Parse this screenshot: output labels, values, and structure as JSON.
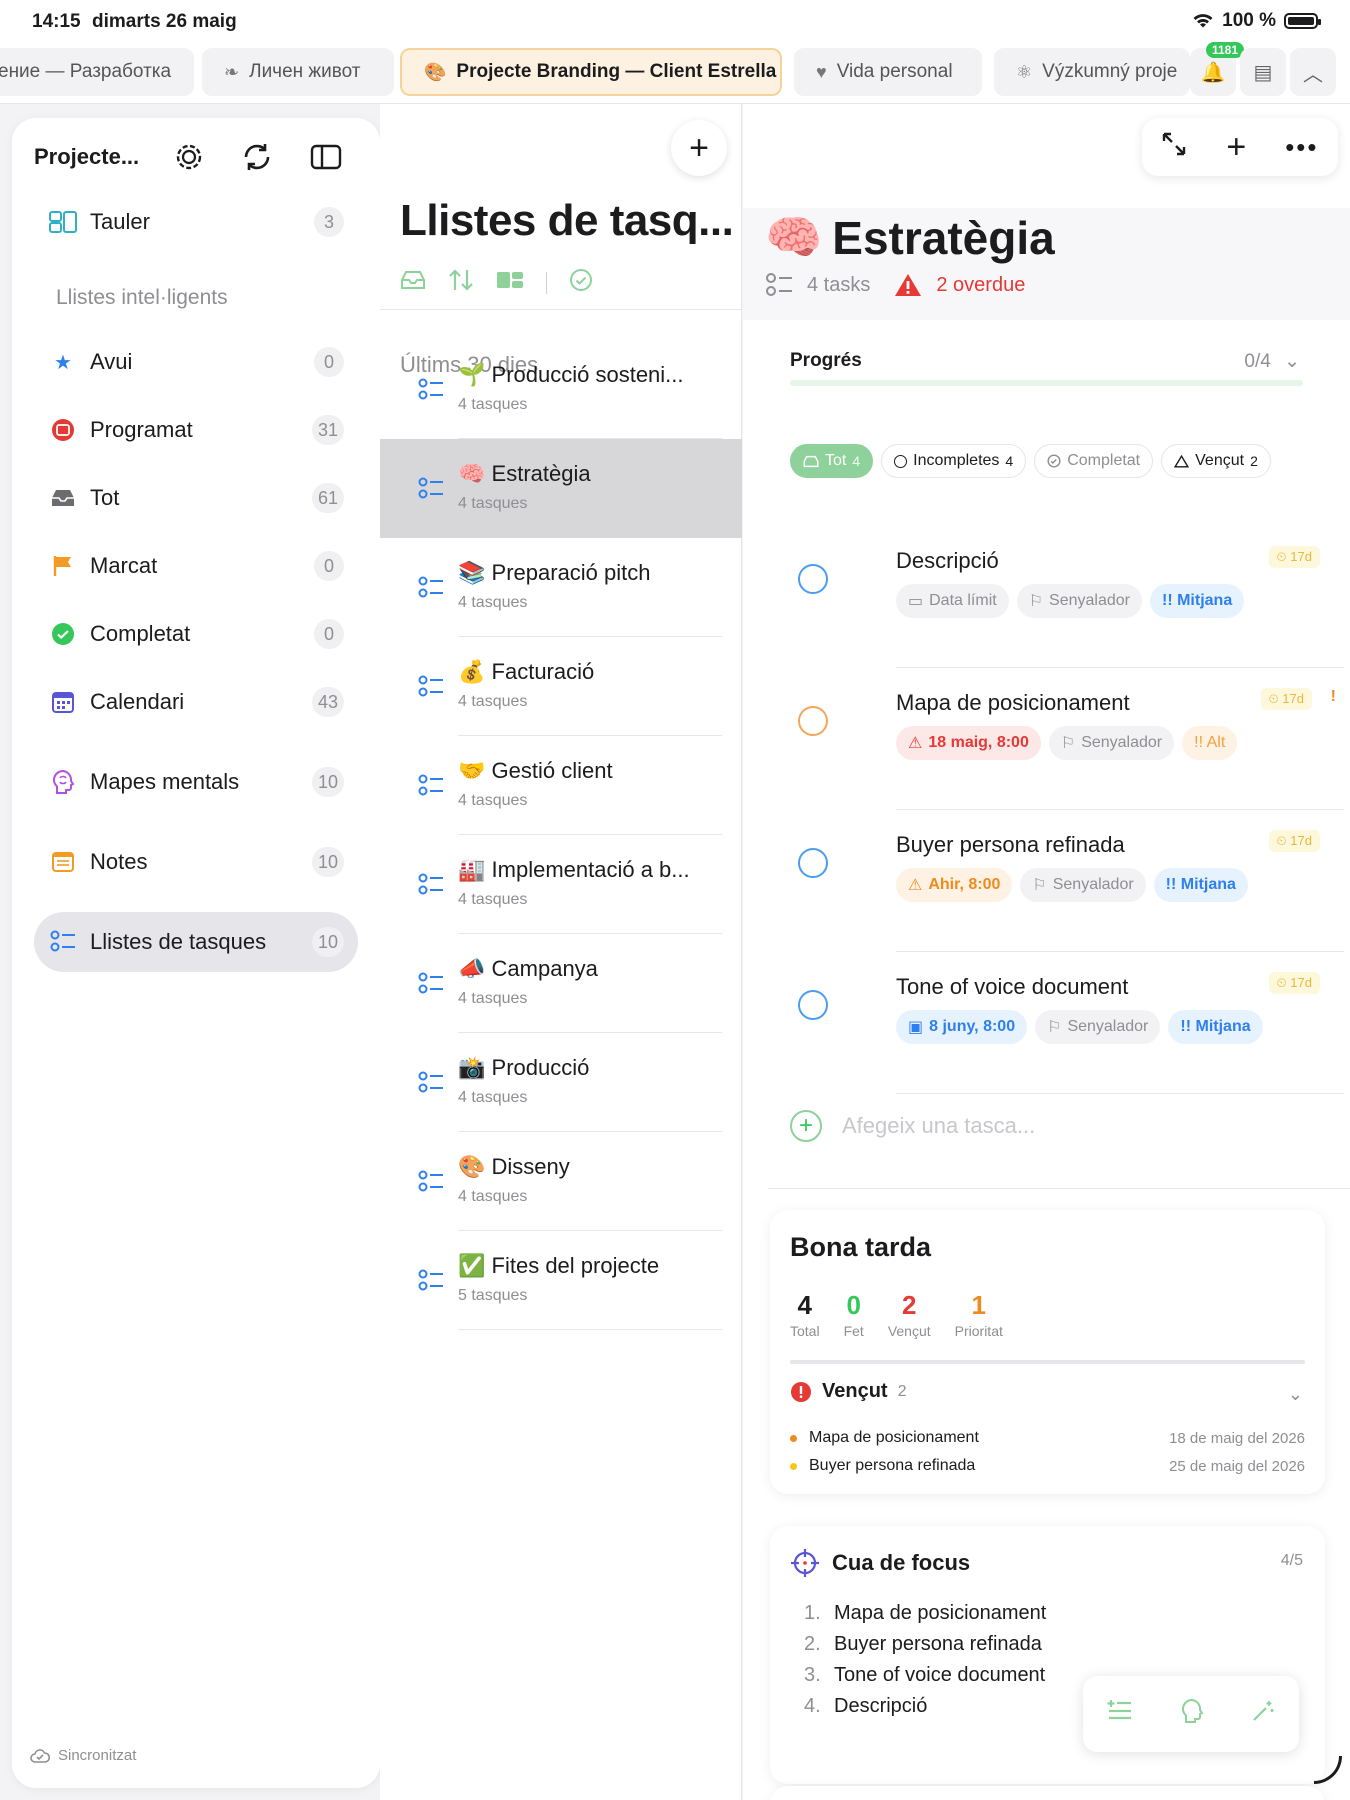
{
  "status_bar": {
    "time": "14:15",
    "date": "dimarts 26 maig",
    "battery": "100 %"
  },
  "tabs": [
    {
      "label": "ение — Разработка",
      "icon": ""
    },
    {
      "label": "Личен живот",
      "icon": "leaf-icon"
    },
    {
      "label": "Projecte Branding — Client Estrella",
      "icon": "palette-icon"
    },
    {
      "label": "Vida personal",
      "icon": "heart-icon"
    },
    {
      "label": "Výzkumný proje",
      "icon": "atom-icon"
    }
  ],
  "notification_badge": "1181",
  "sidebar": {
    "title": "Projecte...",
    "section_label": "Llistes intel·ligents",
    "board": {
      "label": "Tauler",
      "count": "3"
    },
    "smart_lists": [
      {
        "label": "Avui",
        "count": "0",
        "icon": "star-icon",
        "color": "#2f80ed"
      },
      {
        "label": "Programat",
        "count": "31",
        "icon": "calendar-clock-icon",
        "color": "#e53935"
      },
      {
        "label": "Tot",
        "count": "61",
        "icon": "inbox-icon",
        "color": "#6b6b70"
      },
      {
        "label": "Marcat",
        "count": "0",
        "icon": "flag-icon",
        "color": "#f39b25"
      },
      {
        "label": "Completat",
        "count": "0",
        "icon": "check-circle-icon",
        "color": "#34c759"
      },
      {
        "label": "Calendari",
        "count": "43",
        "icon": "calendar-icon",
        "color": "#5856d6"
      }
    ],
    "other": [
      {
        "label": "Mapes mentals",
        "count": "10",
        "icon": "brain-head-icon",
        "color": "#af52de"
      },
      {
        "label": "Notes",
        "count": "10",
        "icon": "notes-icon",
        "color": "#f39b25"
      },
      {
        "label": "Llistes de tasques",
        "count": "10",
        "icon": "list-icon",
        "color": "#2f80ed"
      }
    ],
    "sync_status": "Sincronitzat"
  },
  "middle": {
    "title": "Llistes de tasq...",
    "section": "Últims 30 dies",
    "lists": [
      {
        "emoji": "🌱",
        "name": "Producció sosteni...",
        "sub": "4 tasques"
      },
      {
        "emoji": "🧠",
        "name": "Estratègia",
        "sub": "4 tasques"
      },
      {
        "emoji": "📚",
        "name": "Preparació pitch",
        "sub": "4 tasques"
      },
      {
        "emoji": "💰",
        "name": "Facturació",
        "sub": "4 tasques"
      },
      {
        "emoji": "🤝",
        "name": "Gestió client",
        "sub": "4 tasques"
      },
      {
        "emoji": "🏭",
        "name": "Implementació a b...",
        "sub": "4 tasques"
      },
      {
        "emoji": "📣",
        "name": "Campanya",
        "sub": "4 tasques"
      },
      {
        "emoji": "📸",
        "name": "Producció",
        "sub": "4 tasques"
      },
      {
        "emoji": "🎨",
        "name": "Disseny",
        "sub": "4 tasques"
      },
      {
        "emoji": "✅",
        "name": "Fites del projecte",
        "sub": "5 tasques"
      }
    ]
  },
  "detail": {
    "emoji": "🧠",
    "title": "Estratègia",
    "tasks_count": "4 tasks",
    "overdue": "2 overdue",
    "progress_label": "Progrés",
    "progress_value": "0/4",
    "progress_fraction": 0,
    "filters": [
      {
        "label": "Tot",
        "count": "4"
      },
      {
        "label": "Incompletes",
        "count": "4"
      },
      {
        "label": "Completat",
        "count": ""
      },
      {
        "label": "Vençut",
        "count": "2"
      }
    ],
    "tasks": [
      {
        "name": "Descripció",
        "due_badge": "17d",
        "date": "Data límit",
        "flag": "Senyalador",
        "priority": "!! Mitjana"
      },
      {
        "name": "Mapa de posicionament",
        "due_badge": "17d",
        "date": "18 maig, 8:00",
        "flag": "Senyalador",
        "priority": "!! Alt",
        "bang": "!"
      },
      {
        "name": "Buyer persona refinada",
        "due_badge": "17d",
        "date": "Ahir, 8:00",
        "flag": "Senyalador",
        "priority": "!! Mitjana"
      },
      {
        "name": "Tone of voice document",
        "due_badge": "17d",
        "date": "8 juny, 8:00",
        "flag": "Senyalador",
        "priority": "!! Mitjana"
      }
    ],
    "add_task_placeholder": "Afegeix una tasca..."
  },
  "summary_card": {
    "greeting": "Bona tarda",
    "stats": [
      {
        "num": "4",
        "label": "Total",
        "color": "#1c1c1e"
      },
      {
        "num": "0",
        "label": "Fet",
        "color": "#34c759"
      },
      {
        "num": "2",
        "label": "Vençut",
        "color": "#e53935"
      },
      {
        "num": "1",
        "label": "Prioritat",
        "color": "#ef8a1e"
      }
    ],
    "overdue_label": "Vençut",
    "overdue_count": "2",
    "overdue_items": [
      {
        "name": "Mapa de posicionament",
        "date": "18 de maig del 2026",
        "color": "#ef8a1e"
      },
      {
        "name": "Buyer persona refinada",
        "date": "25 de maig del 2026",
        "color": "#f5c518"
      }
    ]
  },
  "focus_card": {
    "title": "Cua de focus",
    "count": "4/5",
    "items": [
      {
        "idx": "1.",
        "name": "Mapa de posicionament"
      },
      {
        "idx": "2.",
        "name": "Buyer persona refinada"
      },
      {
        "idx": "3.",
        "name": "Tone of voice document"
      },
      {
        "idx": "4.",
        "name": "Descripció"
      }
    ]
  }
}
